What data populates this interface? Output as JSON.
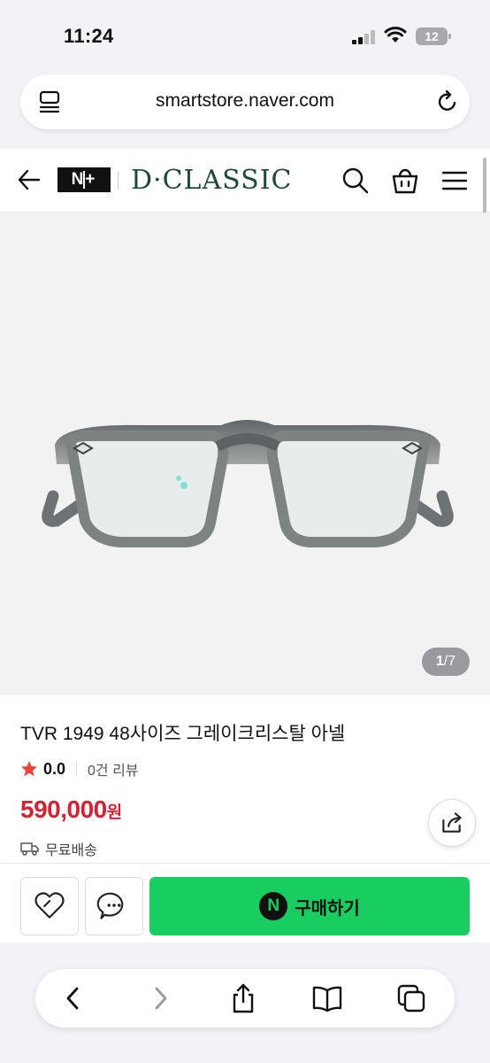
{
  "status": {
    "time": "11:24",
    "battery": "12"
  },
  "browser": {
    "url": "smartstore.naver.com"
  },
  "store": {
    "badge": "N+",
    "brand": "D·CLASSIC"
  },
  "gallery": {
    "current": "1",
    "total": "/7"
  },
  "product": {
    "title": "TVR 1949 48사이즈 그레이크리스탈 아넬",
    "rating": "0.0",
    "reviews": "0건 리뷰",
    "price": "590,000",
    "currency": "원",
    "shipping": "무료배송"
  },
  "actions": {
    "buy_label": "구매하기",
    "npay": "N"
  },
  "colors": {
    "accent_green": "#19ce60",
    "price_red": "#d22334",
    "brand_green": "#1e4a35",
    "star": "#e8433a"
  },
  "icons": [
    "tabs-icon",
    "reload-icon",
    "back-arrow-icon",
    "search-icon",
    "cart-icon",
    "menu-icon",
    "star-icon",
    "share-icon",
    "truck-icon",
    "heart-icon",
    "chat-icon",
    "safari-back-icon",
    "safari-forward-icon",
    "safari-share-icon",
    "bookmarks-icon",
    "tabs-overview-icon"
  ]
}
